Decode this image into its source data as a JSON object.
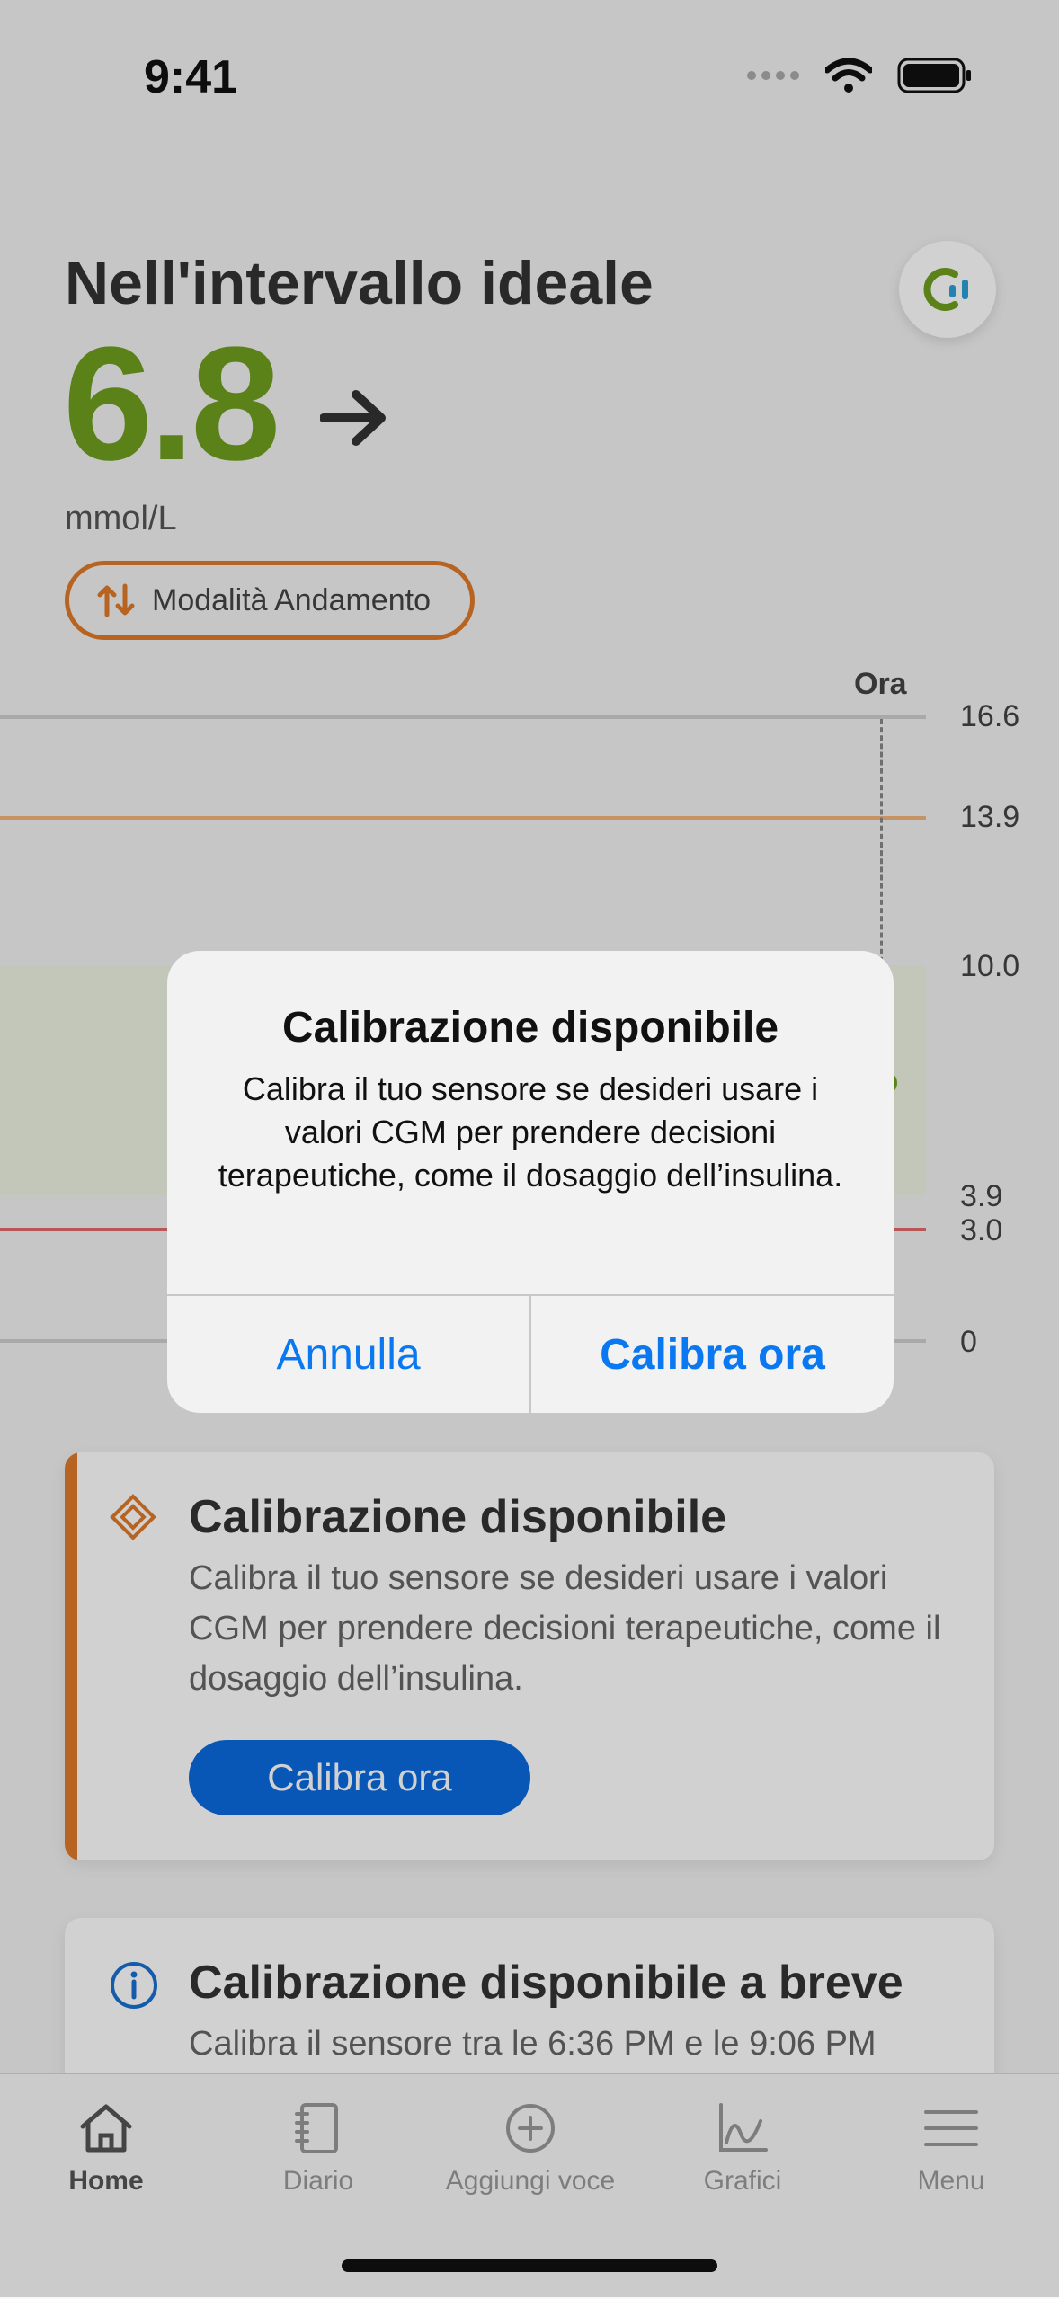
{
  "status_bar": {
    "time": "9:41"
  },
  "header": {
    "status_title": "Nell'intervallo ideale",
    "glucose_value": "6.8",
    "unit": "mmol/L",
    "trend_mode_label": "Modalità Andamento"
  },
  "chart": {
    "now_label": "Ora",
    "y_labels": [
      "16.6",
      "13.9",
      "10.0",
      "3.9",
      "3.0",
      "0"
    ],
    "colors": {
      "high_line": "#f2b47c",
      "low_line": "#e06b6b",
      "target_band": "#eef3e2"
    }
  },
  "cards": {
    "calibration": {
      "title": "Calibrazione disponibile",
      "text": "Calibra il tuo sensore se desideri usare i valori CGM per prendere decisioni terapeutiche, come il dosaggio dell’insulina.",
      "button": "Calibra ora"
    },
    "soon": {
      "title": "Calibrazione disponibile a breve",
      "text": "Calibra il sensore tra le 6:36 PM e le 9:06 PM"
    }
  },
  "dialog": {
    "title": "Calibrazione disponibile",
    "message": "Calibra il tuo sensore se desideri usare i valori CGM per prendere decisioni terapeutiche, come il dosaggio dell’insulina.",
    "cancel": "Annulla",
    "confirm": "Calibra ora"
  },
  "tabs": {
    "home": "Home",
    "diary": "Diario",
    "add": "Aggiungi voce",
    "charts": "Grafici",
    "menu": "Menu"
  },
  "colors": {
    "accent": "#6f9e1f",
    "orange": "#e07b2a",
    "primary": "#0a6be0",
    "ios_blue": "#0a78f0"
  }
}
